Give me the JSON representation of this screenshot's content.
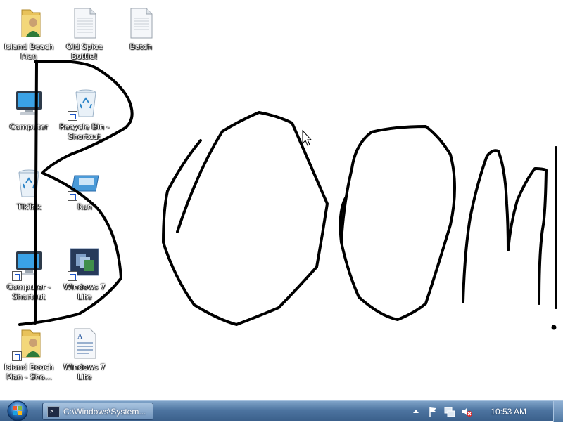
{
  "desktop": {
    "icons": [
      {
        "label": "Island Beach Man",
        "icon": "folder-user-icon",
        "shortcut": false
      },
      {
        "label": "Old Spice Bottle!",
        "icon": "document-icon",
        "shortcut": false
      },
      {
        "label": "Batch",
        "icon": "document-icon",
        "shortcut": false
      },
      {
        "label": "Computer",
        "icon": "computer-icon",
        "shortcut": false
      },
      {
        "label": "Recycle Bin - Shortcut",
        "icon": "recycle-bin-icon",
        "shortcut": true
      },
      {
        "label": "TikTok",
        "icon": "recycle-bin-icon",
        "shortcut": false
      },
      {
        "label": "Run",
        "icon": "run-icon",
        "shortcut": true
      },
      {
        "label": "Computer - Shortcut",
        "icon": "computer-icon",
        "shortcut": true
      },
      {
        "label": "Windows 7 Lite",
        "icon": "windows-app-icon",
        "shortcut": true
      },
      {
        "label": "Island Beach Man - Sho...",
        "icon": "folder-user-icon",
        "shortcut": true
      },
      {
        "label": "Windows 7 Lite",
        "icon": "text-document-icon",
        "shortcut": false
      }
    ],
    "drawing": "Boom"
  },
  "taskbar": {
    "start_label": "Start",
    "task_button": "C:\\Windows\\System...",
    "tray_icons": [
      "show-hidden-icons-icon",
      "action-center-flag-icon",
      "network-icon",
      "volume-muted-icon"
    ],
    "clock": "10:53 AM",
    "colors": {
      "bar": "#4d74a0",
      "text": "#ffffff"
    }
  }
}
